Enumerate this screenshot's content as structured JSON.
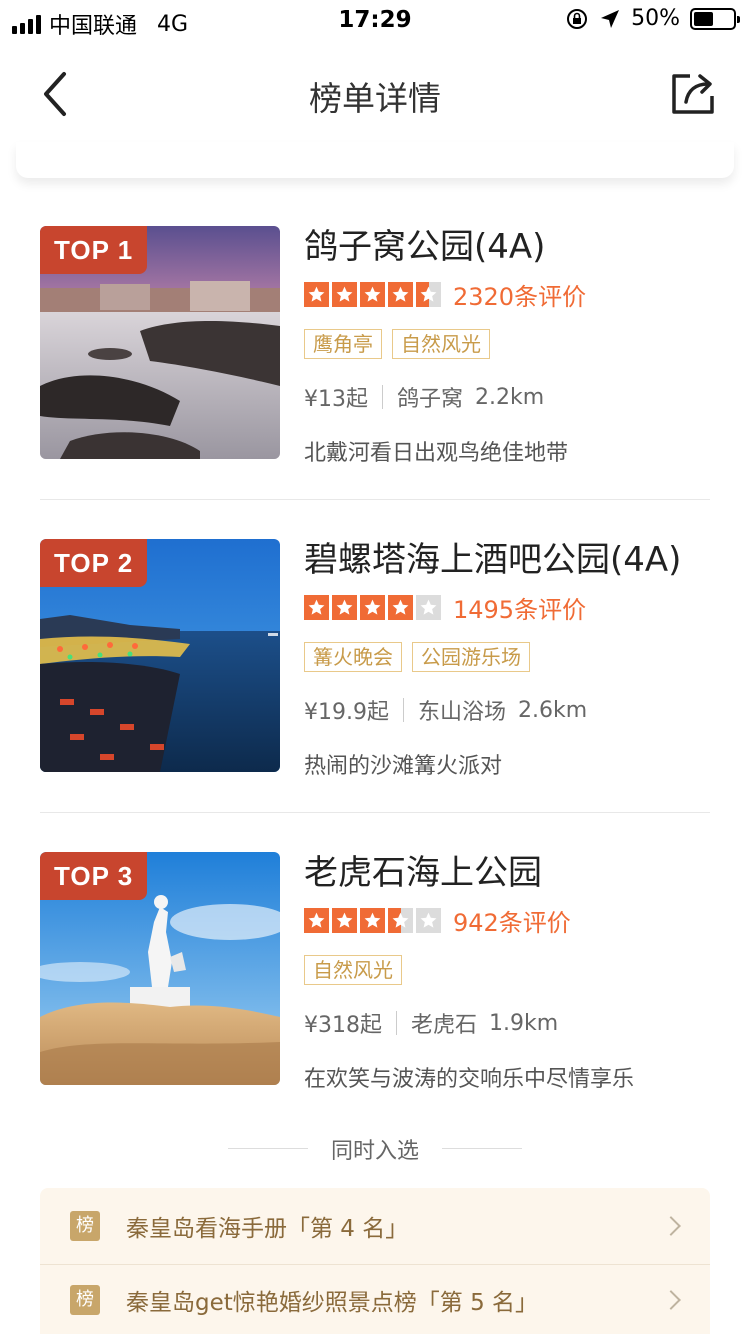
{
  "status_bar": {
    "carrier": "中国联通",
    "network": "4G",
    "time": "17:29",
    "battery": "50%",
    "battery_level": 0.5
  },
  "nav": {
    "title": "榜单详情",
    "back_icon": "chevron-left-icon",
    "share_icon": "share-icon"
  },
  "colors": {
    "accent": "#f06b35",
    "top_tag": "#c8452e",
    "tag_border": "#e9c98a",
    "tag_text": "#c89b4a",
    "board_bg": "#fdf6ec"
  },
  "ranking": [
    {
      "badge": "TOP 1",
      "name": "鸽子窝公园(4A)",
      "rating": 4.5,
      "reviews": "2320条评价",
      "tags": [
        "鹰角亭",
        "自然风光"
      ],
      "price": "¥13起",
      "area": "鸽子窝",
      "distance": "2.2km",
      "description": "北戴河看日出观鸟绝佳地带",
      "image": "sunset-coast-rocks"
    },
    {
      "badge": "TOP 2",
      "name": "碧螺塔海上酒吧公园(4A)",
      "rating": 4,
      "reviews": "1495条评价",
      "tags": [
        "篝火晚会",
        "公园游乐场"
      ],
      "price": "¥19.9起",
      "area": "东山浴场",
      "distance": "2.6km",
      "description": "热闹的沙滩篝火派对",
      "image": "night-beach-lights"
    },
    {
      "badge": "TOP 3",
      "name": "老虎石海上公园",
      "rating": 3.5,
      "reviews": "942条评价",
      "tags": [
        "自然风光"
      ],
      "price": "¥318起",
      "area": "老虎石",
      "distance": "1.9km",
      "description": "在欢笑与波涛的交响乐中尽情享乐",
      "image": "statue-on-rocks"
    }
  ],
  "also_selected": {
    "heading": "同时入选",
    "badge": "榜",
    "items": [
      {
        "label": "秦皇岛看海手册「第 4 名」"
      },
      {
        "label": "秦皇岛get惊艳婚纱照景点榜「第 5 名」"
      }
    ]
  }
}
